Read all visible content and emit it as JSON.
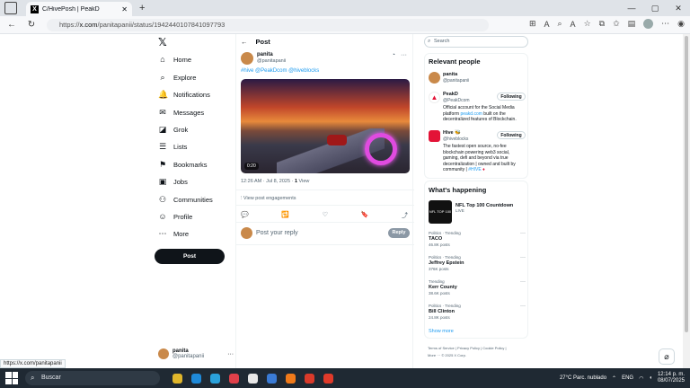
{
  "browser": {
    "tab_title": "C/HivePosh | PeakD",
    "url_prefix": "https://",
    "url_domain": "x.com",
    "url_path": "/panitapanii/status/1942440107841097793",
    "status_bar_url": "https://x.com/panitapanii"
  },
  "leftnav": {
    "logo": "𝕏",
    "items": [
      {
        "label": "Home",
        "icon": "⌂"
      },
      {
        "label": "Explore",
        "icon": "⌕"
      },
      {
        "label": "Notifications",
        "icon": "🔔"
      },
      {
        "label": "Messages",
        "icon": "✉"
      },
      {
        "label": "Grok",
        "icon": "◪"
      },
      {
        "label": "Lists",
        "icon": "☰"
      },
      {
        "label": "Bookmarks",
        "icon": "⚑"
      },
      {
        "label": "Jobs",
        "icon": "▣"
      },
      {
        "label": "Communities",
        "icon": "⚇"
      },
      {
        "label": "Profile",
        "icon": "☺"
      },
      {
        "label": "More",
        "icon": "⋯"
      }
    ],
    "post_label": "Post",
    "me_name": "panita",
    "me_handle": "@panitapanii"
  },
  "post": {
    "back": "←",
    "header": "Post",
    "author_name": "panita",
    "author_handle": "@panitapanii",
    "tags": "#hive @PeakDcom @hiveblocks",
    "video_time": "0:20",
    "meta_time": "12:26 AM · Jul 8, 2025 · ",
    "meta_views": "1",
    "meta_views_label": " View",
    "engagements": "View post engagements",
    "reply_placeholder": "Post your reply",
    "reply_button": "Reply",
    "actions": [
      "💬",
      "🔁",
      "♡",
      "🔖",
      "⤴"
    ]
  },
  "sidebar": {
    "search_placeholder": "Search",
    "relevant_title": "Relevant people",
    "people": [
      {
        "name": "panita",
        "handle": "@panitapanii",
        "bio": "",
        "button": ""
      },
      {
        "name": "PeakD",
        "handle": "@PeakDcom",
        "bio_a": "Official account for the Social Media platform ",
        "bio_link": "peakd.com",
        "bio_b": " built on the decentralized features of Blockchain.",
        "button": "Following"
      },
      {
        "name": "Hive 🐝",
        "handle": "@hiveblocks",
        "bio_a": "The fastest open source, no-fee blockchain powering web3 social, gaming, defi and beyond via true decentralization | owned and built by community | ",
        "bio_link": "#HIVE",
        "bio_b": " ♦",
        "button": "Following"
      }
    ],
    "happening_title": "What's happening",
    "nfl_title": "NFL Top 100 Countdown",
    "nfl_live": "LIVE",
    "nfl_thumb": "NFL TOP 100",
    "trends": [
      {
        "category": "Politics · Trending",
        "title": "TACO",
        "count": "46.8K posts"
      },
      {
        "category": "Politics · Trending",
        "title": "Jeffrey Epstein",
        "count": "376K posts"
      },
      {
        "category": "Trending",
        "title": "Kerr County",
        "count": "38.6K posts"
      },
      {
        "category": "Politics · Trending",
        "title": "Bill Clinton",
        "count": "24.8K posts"
      }
    ],
    "show_more": "Show more",
    "footer_line1": "Terms of Service  |  Privacy Policy  |  Cookie Policy  |",
    "footer_line2": "More ···   © 2025 X Corp."
  },
  "taskbar": {
    "search": "Buscar",
    "weather": "27°C  Parc. nublado",
    "lang": "ENG",
    "time": "12:14 p. m.",
    "date": "08/07/2025"
  }
}
